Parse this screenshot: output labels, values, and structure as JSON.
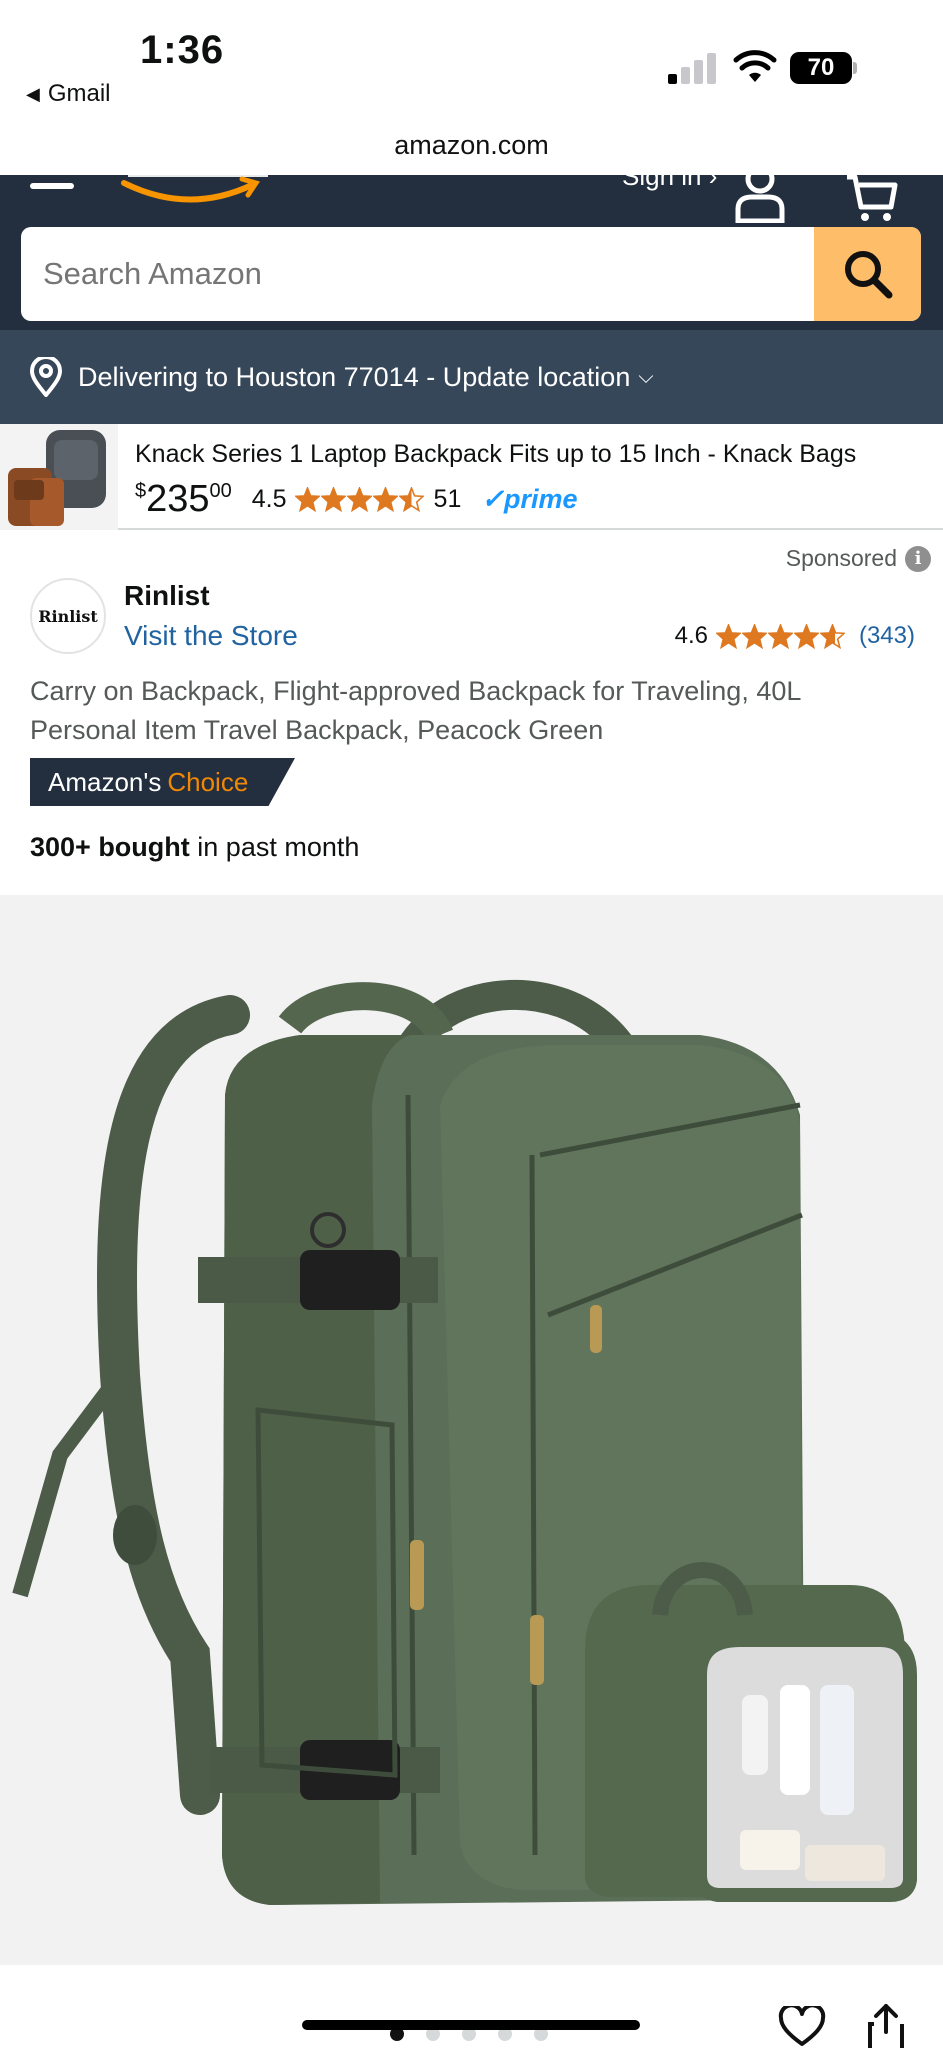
{
  "status_bar": {
    "time": "1:36",
    "back_app": "Gmail",
    "battery": "70"
  },
  "browser": {
    "url": "amazon.com"
  },
  "header": {
    "signin_label": "Sign in ›",
    "search_placeholder": "Search Amazon",
    "location_text": "Delivering to Houston 77014 - Update location"
  },
  "sponsored_ad": {
    "title": "Knack Series 1 Laptop Backpack Fits up to 15 Inch - Knack Bags",
    "price_symbol": "$",
    "price_whole": "235",
    "price_fraction": "00",
    "rating": "4.5",
    "rating_stars": 4.5,
    "review_count": "51",
    "prime_label": "✓prime"
  },
  "product": {
    "sponsored_label": "Sponsored",
    "brand_logo_text": "Rinlist",
    "brand": "Rinlist",
    "visit_store": "Visit the Store",
    "rating": "4.6",
    "rating_stars": 4.6,
    "review_count": "(343)",
    "title": "Carry on Backpack, Flight-approved Backpack for Traveling, 40L Personal Item Travel Backpack, Peacock Green",
    "badge_prefix": "Amazon's",
    "badge_highlight": "Choice",
    "bought_bold": "300+ bought",
    "bought_rest": " in past month",
    "image_count": 5,
    "active_image": 1
  },
  "colors": {
    "header_bg": "#232f3e",
    "location_bg": "#37475a",
    "search_button": "#febd69",
    "link": "#2162a1",
    "star": "#de7921",
    "prime": "#1a98ff",
    "choice_orange": "#f08804",
    "backpack_green": "#5b6e57"
  }
}
